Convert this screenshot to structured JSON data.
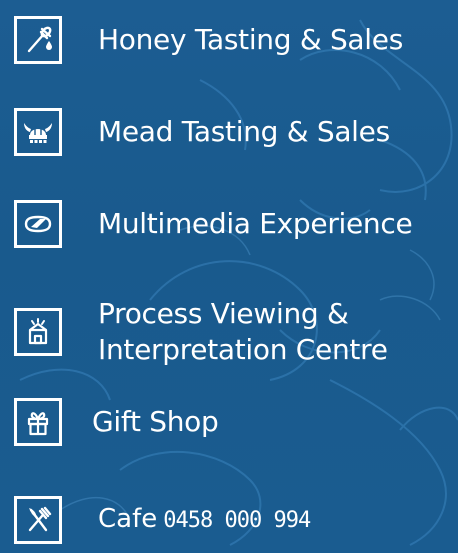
{
  "brand": {
    "background_color": "#1a5a8e",
    "foreground_color": "#ffffff",
    "art_color": "#3a84be"
  },
  "items": [
    {
      "icon": "honey-dipper-icon",
      "label": "Honey Tasting & Sales"
    },
    {
      "icon": "viking-helmet-icon",
      "label": "Mead Tasting & Sales"
    },
    {
      "icon": "multimedia-goggles-icon",
      "label": "Multimedia Experience"
    },
    {
      "icon": "beehive-building-icon",
      "label_line1": "Process Viewing &",
      "label_line2": "Interpretation Centre"
    },
    {
      "icon": "gift-icon",
      "label": "Gift Shop"
    },
    {
      "icon": "fork-knife-icon",
      "label": "Cafe",
      "phone": "0458 000 994"
    }
  ]
}
